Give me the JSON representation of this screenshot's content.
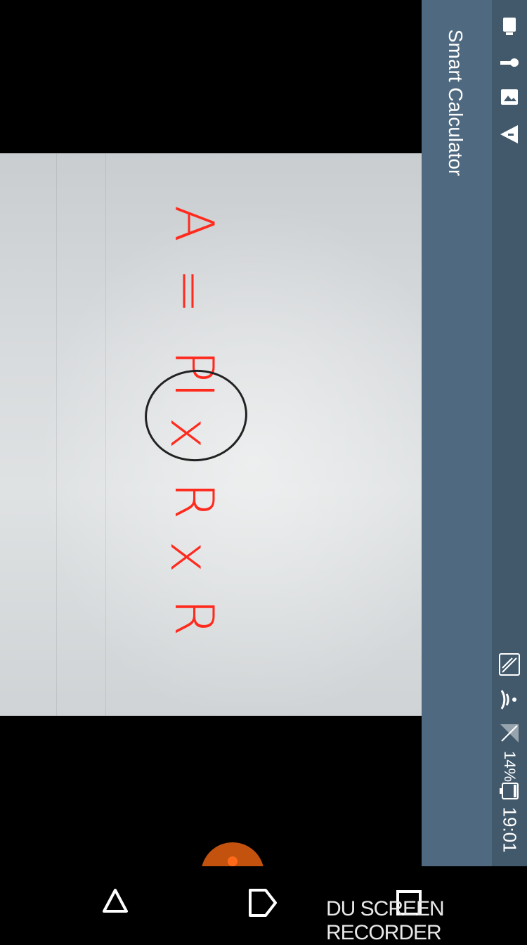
{
  "app": {
    "title": "Smart Calculator"
  },
  "status_bar": {
    "time": "19:01",
    "battery": "14%"
  },
  "camera": {
    "detected_tokens": [
      "A",
      "=",
      "PI",
      "x",
      "R",
      "x",
      "R"
    ]
  },
  "watermark": {
    "text": "DU SCREEN RECORDER"
  },
  "icons": {
    "nav_back": "back-triangle-icon",
    "nav_home": "home-pentagon-icon",
    "nav_recents": "recents-square-icon",
    "capture": "capture-button-icon"
  },
  "colors": {
    "app_bar": "#4f6a80",
    "status_bar": "#42596b",
    "detected_text": "#ff2a1e",
    "capture_button": "#c4520f"
  }
}
